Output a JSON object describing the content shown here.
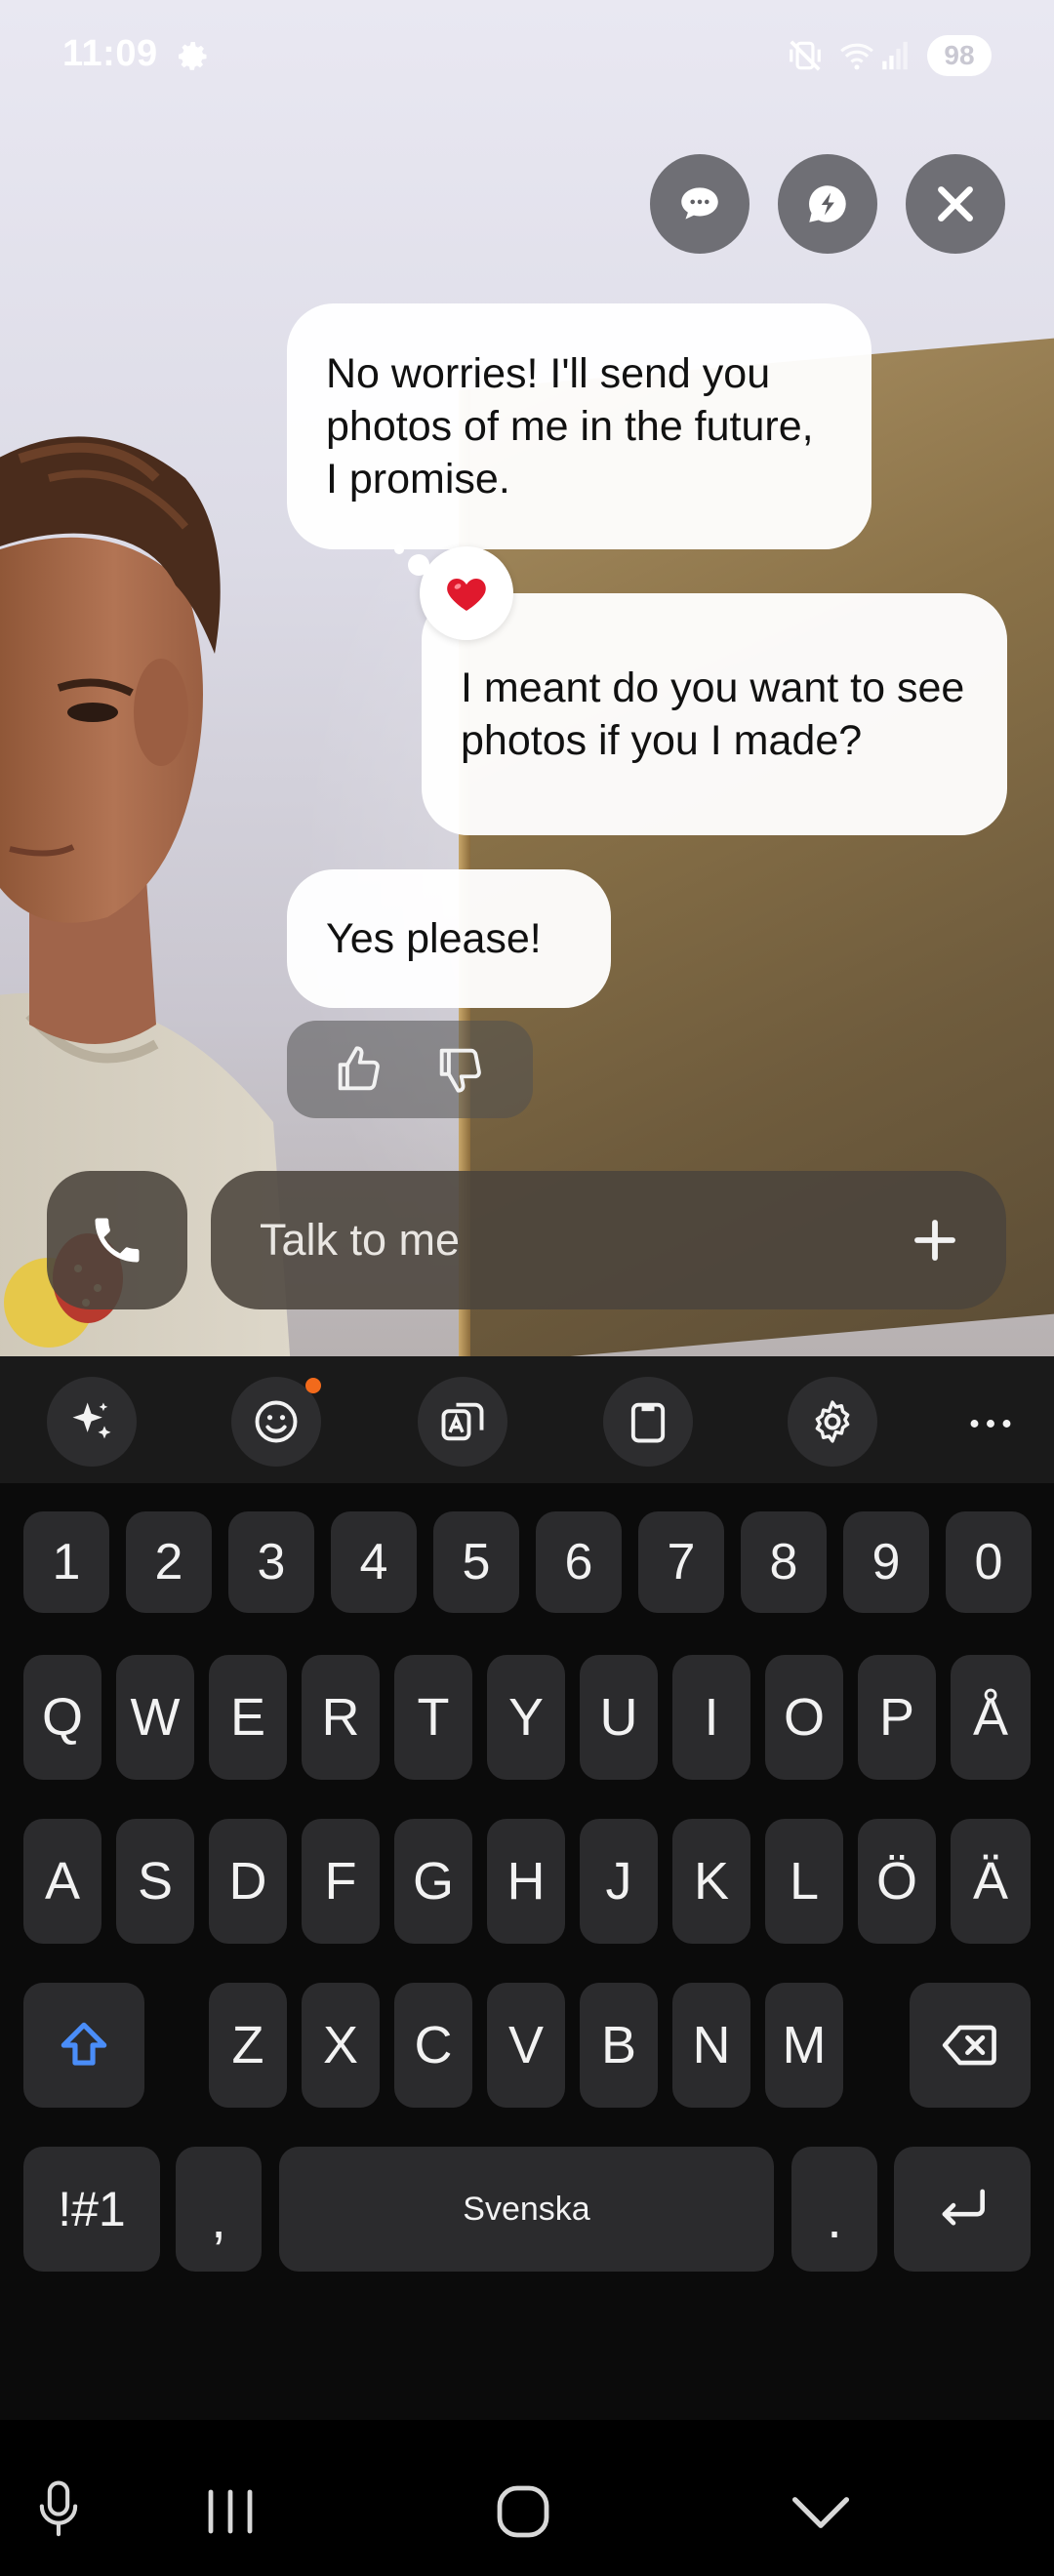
{
  "status_bar": {
    "time": "11:09",
    "battery": "98",
    "icons": [
      "settings-gear-icon",
      "vibrate-mute-icon",
      "wifi-icon",
      "signal-icon",
      "battery-icon"
    ]
  },
  "top_actions": [
    {
      "name": "chat-bubble-icon"
    },
    {
      "name": "quick-reply-icon"
    },
    {
      "name": "close-icon"
    }
  ],
  "messages": [
    {
      "sender": "ai",
      "text": "No worries! I'll send you photos of me in the future, I promise."
    },
    {
      "sender": "user",
      "text": "I meant do you want to see photos if you I made?",
      "reaction": "❤️"
    },
    {
      "sender": "ai",
      "text": "Yes please!"
    }
  ],
  "composer": {
    "placeholder": "Talk to me",
    "call_icon": "phone-icon",
    "add_icon": "plus-icon"
  },
  "keyboard_toolbar": [
    "sparkle-ai-icon",
    "emoji-icon",
    "translate-icon",
    "clipboard-icon",
    "settings-icon",
    "more-icon"
  ],
  "keyboard": {
    "numbers": [
      "1",
      "2",
      "3",
      "4",
      "5",
      "6",
      "7",
      "8",
      "9",
      "0"
    ],
    "row1": [
      "Q",
      "W",
      "E",
      "R",
      "T",
      "Y",
      "U",
      "I",
      "O",
      "P",
      "Å"
    ],
    "row2": [
      "A",
      "S",
      "D",
      "F",
      "G",
      "H",
      "J",
      "K",
      "L",
      "Ö",
      "Ä"
    ],
    "row3": [
      "Z",
      "X",
      "C",
      "V",
      "B",
      "N",
      "M"
    ],
    "symbols_key": "!#1",
    "comma_key": ",",
    "space_label": "Svenska",
    "period_key": "."
  },
  "colors": {
    "bubble": "#ffffff",
    "keyboard_bg": "#0b0b0b",
    "key_bg": "#2b2b2d",
    "shift_accent": "#4a8df8",
    "notification_dot": "#f26a1b"
  }
}
